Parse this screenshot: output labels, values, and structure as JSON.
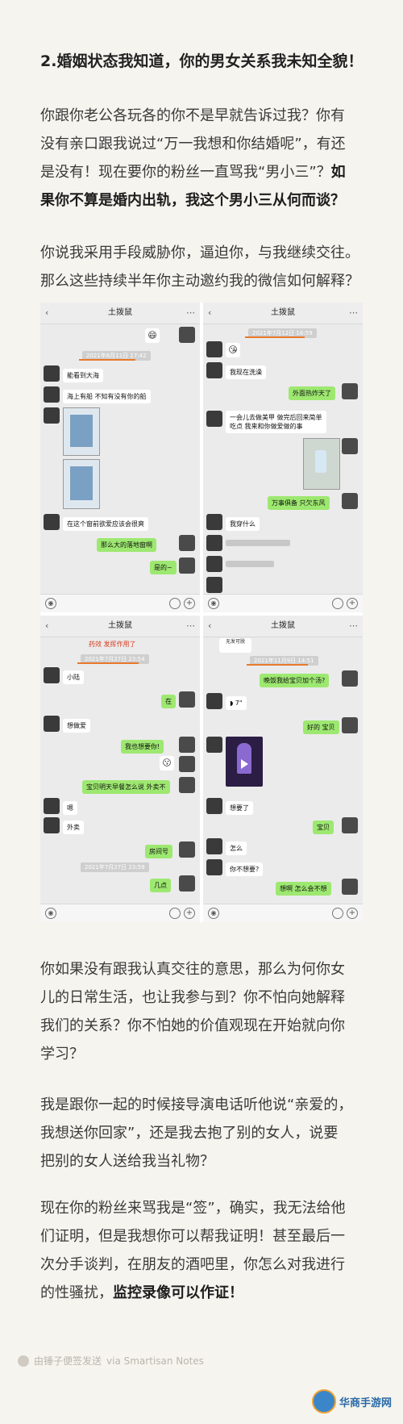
{
  "heading": "2.婚姻状态我知道，你的男女关系我未知全貌！",
  "paragraphs": {
    "p1_line1": "你跟你老公各玩各的你不是早就告诉过我？你有",
    "p1_line2": "没有亲口跟我说过“万一我想和你结婚呢”，有还",
    "p1_line3_a": "是没有！现在要你的粉丝一直骂我“男小三”？",
    "p1_line3_b": "如",
    "p1_line4": "果你不算是婚内出轨，我这个男小三从何而谈？",
    "p2_line1": "你说我采用手段威胁你，逼迫你，与我继续交往。",
    "p2_line2": "那么这些持续半年你主动邀约我的微信如何解释？",
    "p3_line1": "你如果没有跟我认真交往的意思，那么为何你女",
    "p3_line2": "儿的日常生活，也让我参与到？你不怕向她解释",
    "p3_line3": "我们的关系？你不怕她的价值观现在开始就向你",
    "p3_line4": "学习？",
    "p4_line1": "我是跟你一起的时候接导演电话听他说“亲爱的，",
    "p4_line2": "我想送你回家”，还是我去抱了别的女人，说要",
    "p4_line3": "把别的女人送给我当礼物？",
    "p5_line1": "现在你的粉丝来骂我是“签”，确实，我无法给他",
    "p5_line2": "们证明，但是我想你可以帮我证明！甚至最后一",
    "p5_line3": "次分手谈判，在朋友的酒吧里，你怎么对我进行",
    "p5_line4_a": "的性骚扰，",
    "p5_line4_b": "监控录像可以作证！"
  },
  "phones": [
    {
      "title": "土拨鼠",
      "timestamp": "2021年6月11日 17:42",
      "messages": [
        "能看到大海",
        "海上有船 不知有没有你的船",
        "在这个窗前欲爱应该会很爽",
        "那么大的落地窗啊",
        "是的~"
      ]
    },
    {
      "title": "土拨鼠",
      "timestamp": "2021年7月12日 16:59",
      "messages": [
        "我现在洗澡",
        "外面热炸天了",
        "一会儿去做美甲 做完后回来简单",
        "吃点 我来和你做爱做的事",
        "万事俱备 只欠东风",
        "我穿什么"
      ]
    },
    {
      "title": "土拨鼠",
      "timestamp": "2021年7月27日 23:54",
      "timestamp2": "2021年7月27日 23:59",
      "top_text": "药效 发挥作用了",
      "messages": [
        "小陆",
        "在",
        "想做爱",
        "我也想要你!",
        "宝贝明天早餐怎么说 外卖不",
        "嗯",
        "外卖",
        "房间号",
        "几点"
      ]
    },
    {
      "title": "土拨鼠",
      "timestamp": "2021年11月9日 14:51",
      "top_text": "无发可脱",
      "messages": [
        "晚饭我给宝贝加个汤?",
        "7\"",
        "好的 宝贝",
        "想要了",
        "宝贝",
        "怎么",
        "你不想要?",
        "想啊 怎么会不想"
      ]
    }
  ],
  "footer": {
    "text": "由锤子便签发送",
    "via": "via Smartisan Notes"
  },
  "watermark": "华商手游网"
}
